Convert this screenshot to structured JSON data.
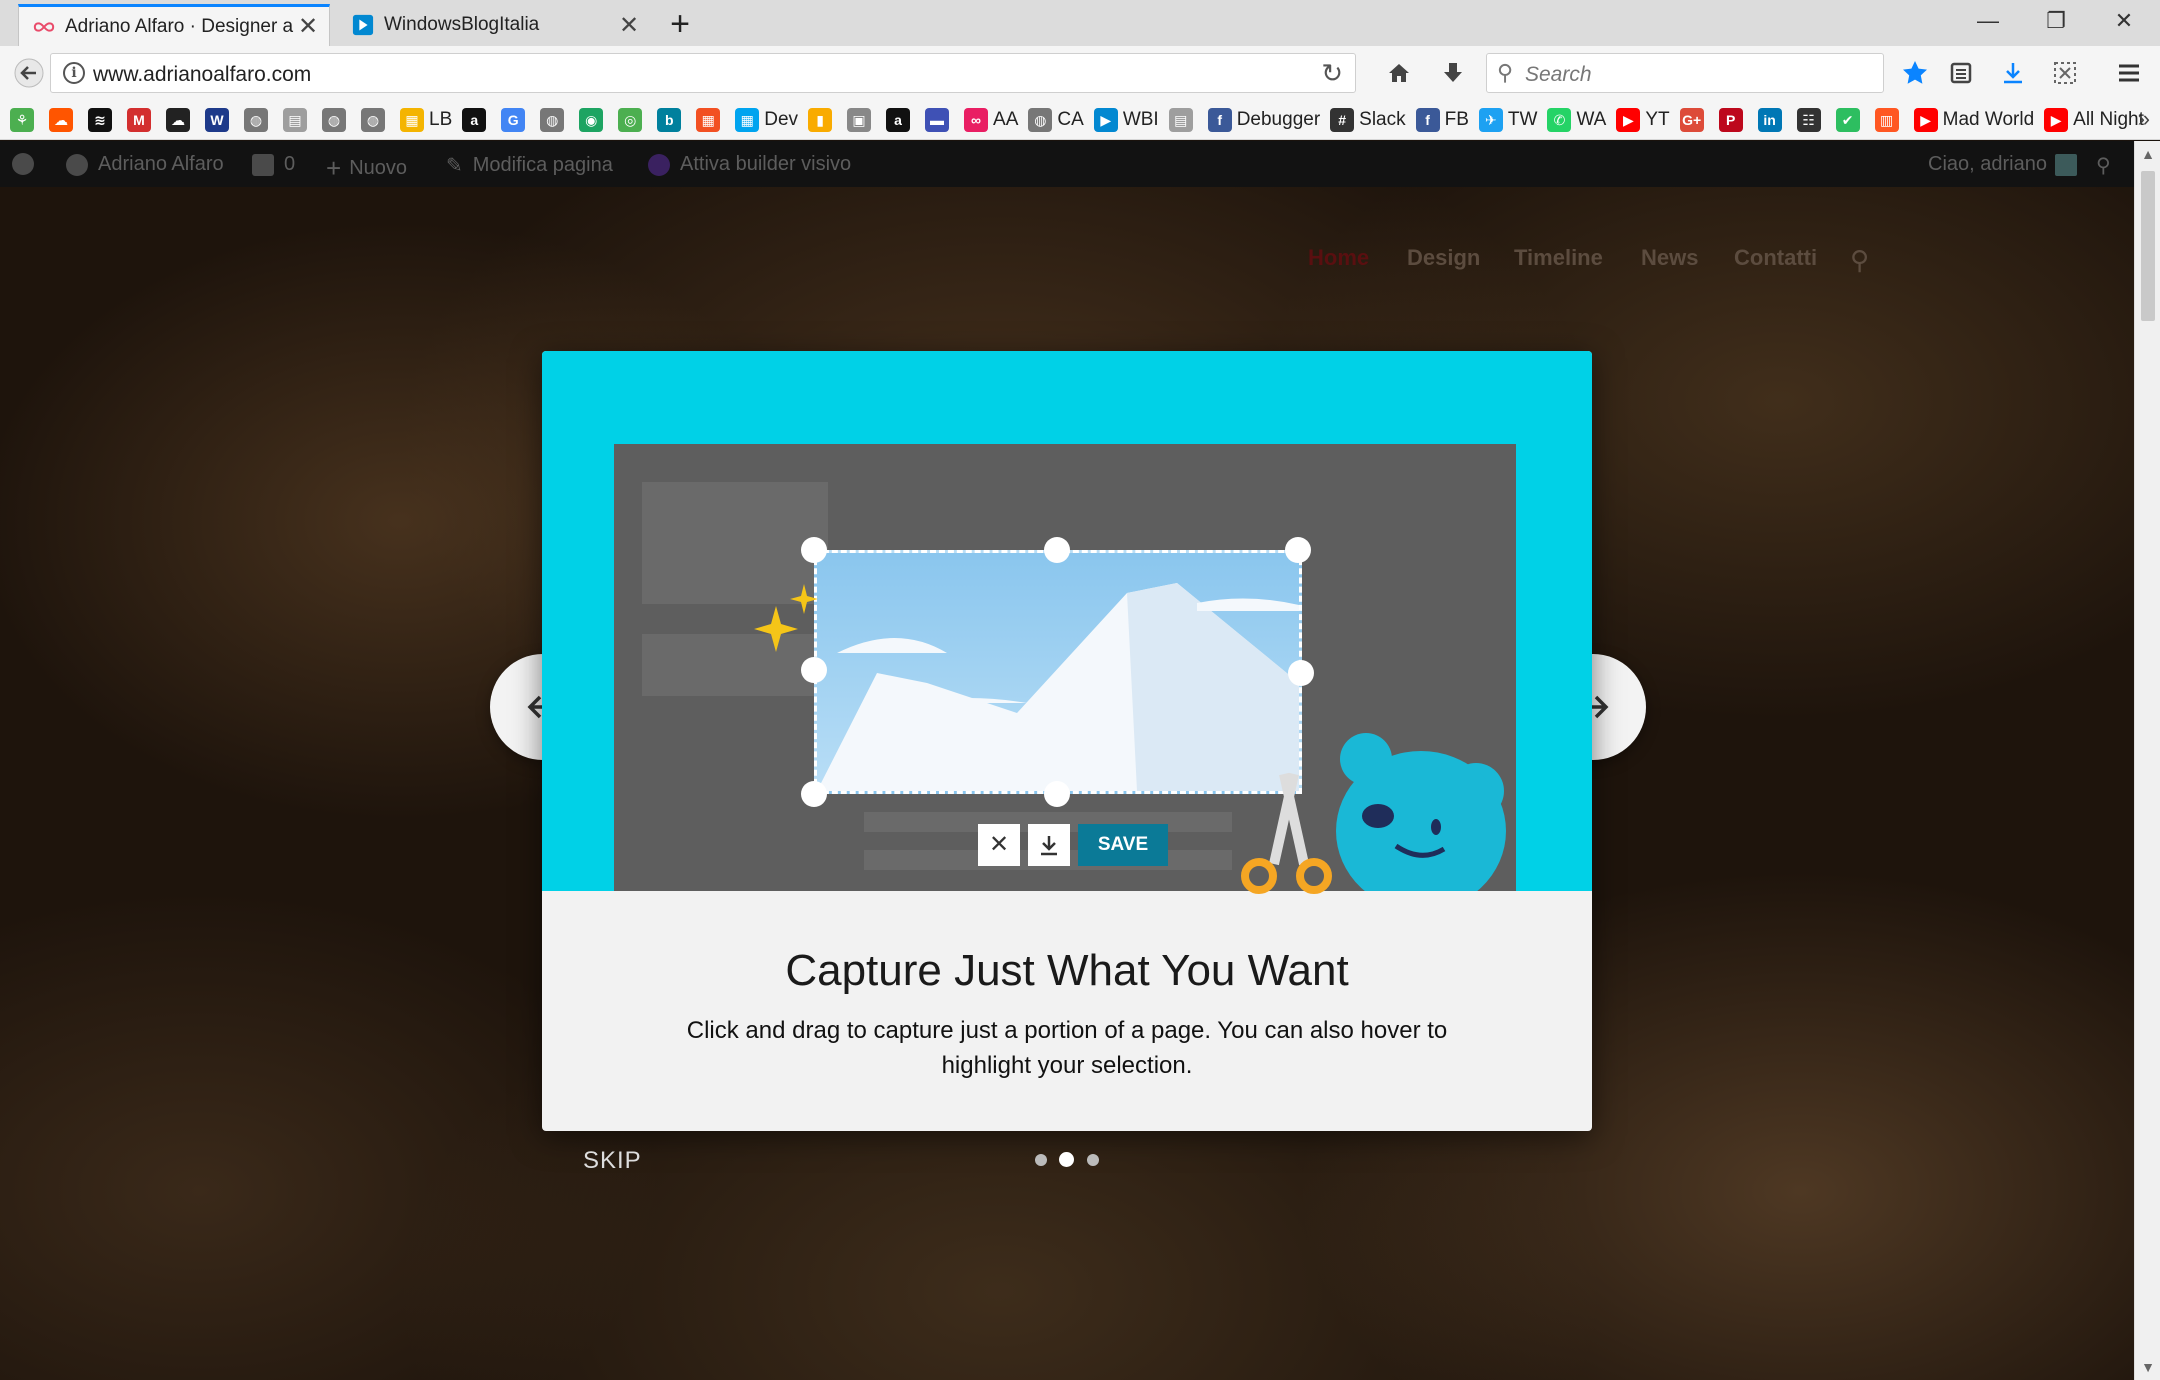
{
  "tabs": [
    {
      "title": "Adriano Alfaro · Designer a S",
      "active": true
    },
    {
      "title": "WindowsBlogItalia",
      "active": false
    }
  ],
  "window_controls": {
    "minimize": "—",
    "restore": "❐",
    "close": "✕"
  },
  "navbar": {
    "url": "www.adrianoalfaro.com",
    "search_placeholder": "Search"
  },
  "bookmarks": [
    {
      "label": "",
      "color": "#4caf50",
      "glyph": "⚘"
    },
    {
      "label": "",
      "color": "#ff5500",
      "glyph": "☁"
    },
    {
      "label": "",
      "color": "#111111",
      "glyph": "≋"
    },
    {
      "label": "",
      "color": "#d32f2f",
      "glyph": "M"
    },
    {
      "label": "",
      "color": "#222222",
      "glyph": "☁"
    },
    {
      "label": "",
      "color": "#1e3a8a",
      "glyph": "W"
    },
    {
      "label": "",
      "color": "#777777",
      "glyph": "◍"
    },
    {
      "label": "",
      "color": "#9e9e9e",
      "glyph": "▤"
    },
    {
      "label": "",
      "color": "#777777",
      "glyph": "◍"
    },
    {
      "label": "",
      "color": "#777777",
      "glyph": "◍"
    },
    {
      "label": "LB",
      "color": "#f4b400",
      "glyph": "▦"
    },
    {
      "label": "",
      "color": "#111111",
      "glyph": "a"
    },
    {
      "label": "",
      "color": "#4285f4",
      "glyph": "G"
    },
    {
      "label": "",
      "color": "#777777",
      "glyph": "◍"
    },
    {
      "label": "",
      "color": "#1da462",
      "glyph": "◉"
    },
    {
      "label": "",
      "color": "#4caf50",
      "glyph": "◎"
    },
    {
      "label": "",
      "color": "#00809d",
      "glyph": "b"
    },
    {
      "label": "",
      "color": "#f25022",
      "glyph": "▦"
    },
    {
      "label": "Dev",
      "color": "#00a4ef",
      "glyph": "▦"
    },
    {
      "label": "",
      "color": "#f9ab00",
      "glyph": "▮"
    },
    {
      "label": "",
      "color": "#888888",
      "glyph": "▣"
    },
    {
      "label": "",
      "color": "#111111",
      "glyph": "a"
    },
    {
      "label": "",
      "color": "#3f51b5",
      "glyph": "▬"
    },
    {
      "label": "AA",
      "color": "#e91e63",
      "glyph": "∞"
    },
    {
      "label": "CA",
      "color": "#777777",
      "glyph": "◍"
    },
    {
      "label": "WBI",
      "color": "#0288d1",
      "glyph": "▶"
    },
    {
      "label": "",
      "color": "#9e9e9e",
      "glyph": "▤"
    },
    {
      "label": "Debugger",
      "color": "#3b5998",
      "glyph": "f"
    },
    {
      "label": "Slack",
      "color": "#333333",
      "glyph": "#"
    },
    {
      "label": "FB",
      "color": "#3b5998",
      "glyph": "f"
    },
    {
      "label": "TW",
      "color": "#1da1f2",
      "glyph": "✈"
    },
    {
      "label": "WA",
      "color": "#25d366",
      "glyph": "✆"
    },
    {
      "label": "YT",
      "color": "#ff0000",
      "glyph": "▶"
    },
    {
      "label": "",
      "color": "#dd4b39",
      "glyph": "G+"
    },
    {
      "label": "",
      "color": "#bd081c",
      "glyph": "P"
    },
    {
      "label": "",
      "color": "#0077b5",
      "glyph": "in"
    },
    {
      "label": "",
      "color": "#333333",
      "glyph": "☷"
    },
    {
      "label": "",
      "color": "#2dbe60",
      "glyph": "✔"
    },
    {
      "label": "",
      "color": "#ff5722",
      "glyph": "▥"
    },
    {
      "label": "Mad World",
      "color": "#ff0000",
      "glyph": "▶"
    },
    {
      "label": "All Night",
      "color": "#ff0000",
      "glyph": "▶"
    }
  ],
  "bookmarks_overflow": "»",
  "wp_admin_bar": {
    "site_name": "Adriano Alfaro",
    "comments_count": "0",
    "new_label": "Nuovo",
    "edit_label": "Modifica pagina",
    "builder_label": "Attiva builder visivo",
    "greeting": "Ciao, adriano"
  },
  "site_nav": [
    "Home",
    "Design",
    "Timeline",
    "News",
    "Contatti"
  ],
  "modal": {
    "hero_color": "#00d1e7",
    "save_label": "SAVE",
    "title": "Capture Just What You Want",
    "description": "Click and drag to capture just a portion of a page. You can also hover to highlight your selection.",
    "skip_label": "SKIP",
    "dots": 3,
    "active_dot": 2
  },
  "colors": {
    "accent": "#0a84ff",
    "save_button": "#0b7a97",
    "mascot": "#1ab8d6",
    "scissors": "#f5a623"
  }
}
